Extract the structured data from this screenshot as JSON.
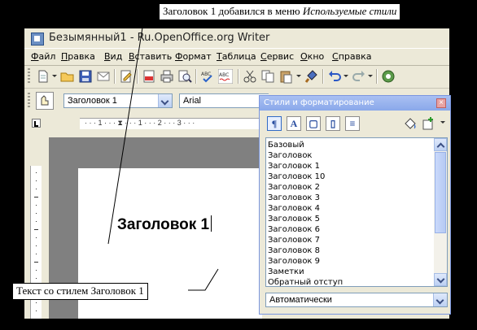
{
  "window": {
    "title": "Безымянный1 - Ru.OpenOffice.org Writer"
  },
  "menu": [
    "Файл",
    "Правка",
    "Вид",
    "Вставить",
    "Формат",
    "Таблица",
    "Сервис",
    "Окно",
    "Справка"
  ],
  "toolbar": {
    "style_value": "Заголовок 1",
    "font_value": "Arial"
  },
  "ruler": {
    "ticks": "· · · 1 · · · ⧗ · · · 1 · · · 2 · · · 3 · · ·"
  },
  "document": {
    "heading_text": "Заголовок 1"
  },
  "styles_panel": {
    "title": "Стили и форматирование",
    "close_glyph": "×",
    "items": [
      "Базовый",
      "Заголовок",
      "Заголовок 1",
      "Заголовок 10",
      "Заголовок 2",
      "Заголовок 3",
      "Заголовок 4",
      "Заголовок 5",
      "Заголовок 6",
      "Заголовок 7",
      "Заголовок 8",
      "Заголовок 9",
      "Заметки",
      "Обратный отступ"
    ],
    "filter_value": "Автоматически"
  },
  "callouts": {
    "top_plain": "Заголовок 1 добавился в меню ",
    "top_italic": "Используемые стили",
    "bottom": "Текст со стилем Заголовок 1"
  },
  "icons": [
    "new-document-icon",
    "open-folder-icon",
    "save-icon",
    "email-icon",
    "edit-icon",
    "pdf-icon",
    "print-icon",
    "preview-icon",
    "spellcheck-icon",
    "autospell-icon",
    "cut-icon",
    "copy-icon",
    "paste-icon",
    "format-paintbrush-icon",
    "undo-icon",
    "redo-icon",
    "navigator-icon"
  ]
}
